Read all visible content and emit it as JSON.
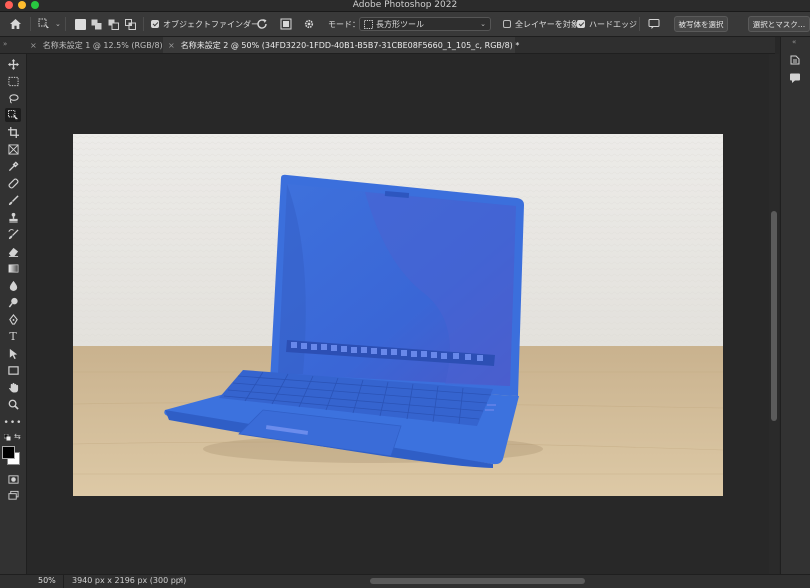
{
  "window": {
    "title": "Adobe Photoshop 2022"
  },
  "options": {
    "auto_select_label": "オブジェクトファインダー",
    "mode_label": "モード：",
    "mode_value": "長方形ツール",
    "sample_all_layers_label": "全レイヤーを対象",
    "hard_edge_label": "ハードエッジ",
    "select_subject_label": "被写体を選択",
    "select_mask_label": "選択とマスク…"
  },
  "tabs": [
    {
      "label": "名称未設定 1 @ 12.5% (RGB/8)",
      "active": false
    },
    {
      "label": "名称未設定 2 @ 50% (34FD3220-1FDD-40B1-B5B7-31CBE08F5660_1_105_c, RGB/8) *",
      "active": true
    }
  ],
  "status": {
    "zoom": "50%",
    "doc_info": "3940 px x 2196 px (300 ppi)",
    "arrow": "›"
  },
  "tools": [
    "move-tool-icon",
    "marquee-tool-icon",
    "lasso-tool-icon",
    "object-selection-tool-icon",
    "crop-tool-icon",
    "frame-tool-icon",
    "eyedropper-tool-icon",
    "healing-brush-icon",
    "brush-tool-icon",
    "clone-stamp-icon",
    "history-brush-icon",
    "eraser-tool-icon",
    "gradient-tool-icon",
    "blur-tool-icon",
    "dodge-tool-icon",
    "pen-tool-icon",
    "type-tool-icon",
    "path-selection-icon",
    "rectangle-tool-icon",
    "hand-tool-icon",
    "zoom-tool-icon",
    "more-tools-icon"
  ],
  "colors": {
    "accent": "#3d74e0",
    "panel": "#393939",
    "background": "#282828"
  }
}
